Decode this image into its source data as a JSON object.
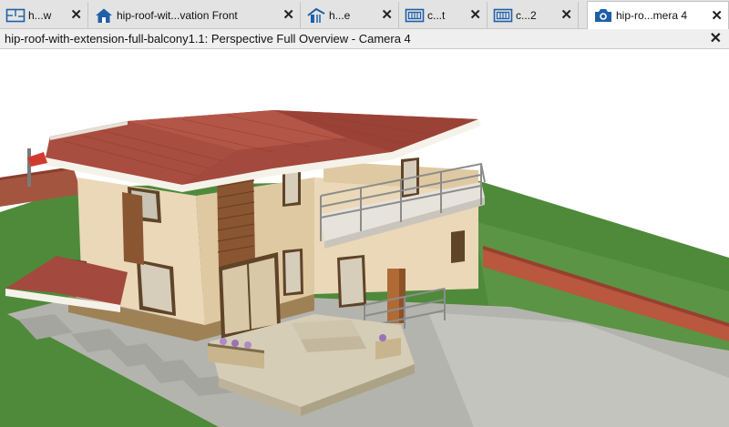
{
  "tabs": [
    {
      "label": "h...w",
      "icon": "floor-plan-icon",
      "active": false
    },
    {
      "label": "hip-roof-wit...vation Front",
      "icon": "house-elevation-icon",
      "active": false
    },
    {
      "label": "h...e",
      "icon": "cross-section-icon",
      "active": false
    },
    {
      "label": "c...t",
      "icon": "framing-view-icon",
      "active": false
    },
    {
      "label": "c...2",
      "icon": "framing-view-icon",
      "active": false
    },
    {
      "label": "hip-ro...mera 4",
      "icon": "camera-icon",
      "active": true
    }
  ],
  "window": {
    "title": "hip-roof-with-extension-full-balcony1.1: Perspective Full Overview - Camera 4"
  },
  "close_glyph": "✕",
  "colors": {
    "roof": "#a4493d",
    "wall": "#ead8b8",
    "grass": "#4f8a3a",
    "paving": "#b4b4ae",
    "deck": "#c9713f",
    "pool": "#39b6d6",
    "tab_bar": "#e3e3e3"
  }
}
